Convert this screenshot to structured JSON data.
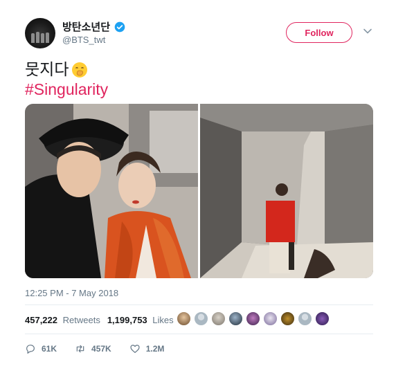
{
  "tweet": {
    "display_name": "방탄소년단",
    "handle": "@BTS_twt",
    "verified": true,
    "follow_label": "Follow",
    "text_line1": "뭇지다",
    "emoji": "hand-over-mouth-emoji",
    "hashtag": "#Singularity",
    "timestamp": "12:25 PM - 7 May 2018",
    "retweets_count": "457,222",
    "retweets_label": "Retweets",
    "likes_count": "1,199,753",
    "likes_label": "Likes",
    "reply_count": "61K",
    "retweet_action_count": "457K",
    "like_action_count": "1.2M"
  },
  "colors": {
    "accent": "#e0245e",
    "text": "#14171a",
    "muted": "#657786",
    "verified": "#1da1f2",
    "divider": "#e6ecf0"
  },
  "icons": {
    "more": "chevron-down-icon",
    "reply": "reply-icon",
    "retweet": "retweet-icon",
    "like": "heart-icon"
  }
}
